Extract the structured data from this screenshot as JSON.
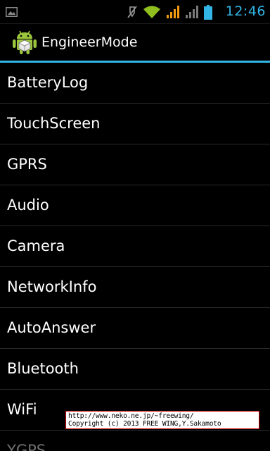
{
  "status_bar": {
    "time": "12:46",
    "icons": [
      "picture-icon",
      "mute-icon",
      "wifi-icon",
      "signal-orange-icon",
      "signal-grey-icon",
      "battery-icon"
    ]
  },
  "action_bar": {
    "title": "EngineerMode",
    "icon": "android-robot-icon",
    "accent_color": "#33b5e5"
  },
  "menu": {
    "items": [
      {
        "label": "BatteryLog"
      },
      {
        "label": "TouchScreen"
      },
      {
        "label": "GPRS"
      },
      {
        "label": "Audio"
      },
      {
        "label": "Camera"
      },
      {
        "label": "NetworkInfo"
      },
      {
        "label": "AutoAnswer"
      },
      {
        "label": "Bluetooth"
      },
      {
        "label": "WiFi"
      },
      {
        "label": "YGPS"
      }
    ]
  },
  "watermark": {
    "url": "http://www.neko.ne.jp/~freewing/",
    "copyright": "Copyright (c) 2013 FREE WING,Y.Sakamoto"
  }
}
